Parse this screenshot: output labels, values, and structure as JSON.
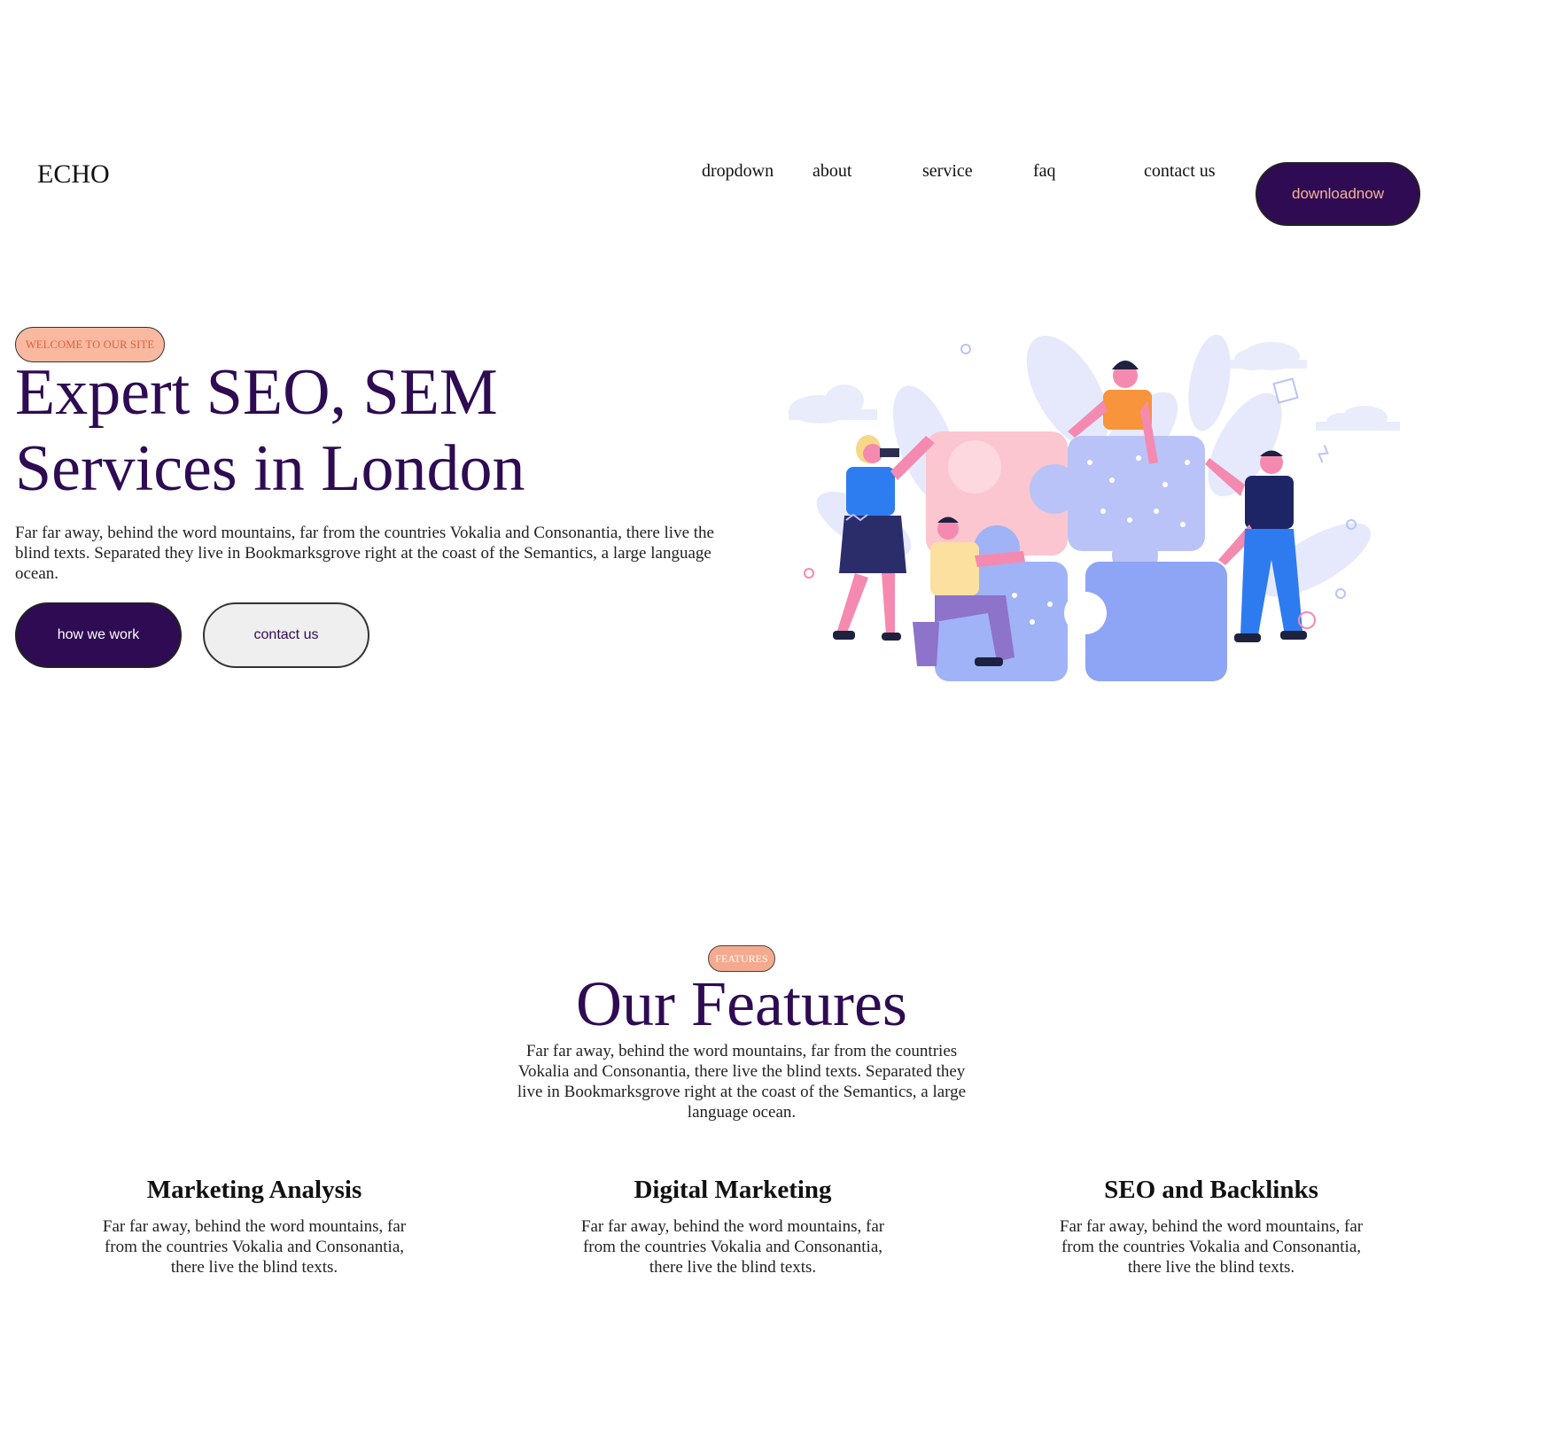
{
  "header": {
    "logo": "ECHO",
    "nav": [
      {
        "label": "dropdown"
      },
      {
        "label": "about"
      },
      {
        "label": "service"
      },
      {
        "label": "faq"
      },
      {
        "label": "contact us"
      }
    ],
    "download_label": "downloadnow"
  },
  "hero": {
    "badge": "WELCOME TO OUR SITE",
    "title_line1": "Expert SEO, SEM",
    "title_line2": "Services in London",
    "text": "Far far away, behind the word mountains, far from the countries Vokalia and Consonantia, there live the blind texts. Separated they live in Bookmarksgrove right at the coast of the Semantics, a large language ocean.",
    "primary_button": "how we work",
    "secondary_button": "contact us"
  },
  "features": {
    "badge": "FEATURES",
    "title": "Our Features",
    "text": "Far far away, behind the word mountains, far from the countries Vokalia and Consonantia, there live the blind texts. Separated they live in Bookmarksgrove right at the coast of the Semantics, a large language ocean.",
    "items": [
      {
        "title": "Marketing Analysis",
        "text": "Far far away, behind the word mountains, far from the countries Vokalia and Consonantia, there live the blind texts."
      },
      {
        "title": "Digital Marketing",
        "text": "Far far away, behind the word mountains, far from the countries Vokalia and Consonantia, there live the blind texts."
      },
      {
        "title": "SEO and Backlinks",
        "text": "Far far away, behind the word mountains, far from the countries Vokalia and Consonantia, there live the blind texts."
      }
    ]
  },
  "colors": {
    "brand_purple": "#2e0b52",
    "accent_peach": "#f8b9a0",
    "accent_orange_text": "#e0603d"
  },
  "illustration": {
    "icon": "team-puzzle-illustration"
  }
}
